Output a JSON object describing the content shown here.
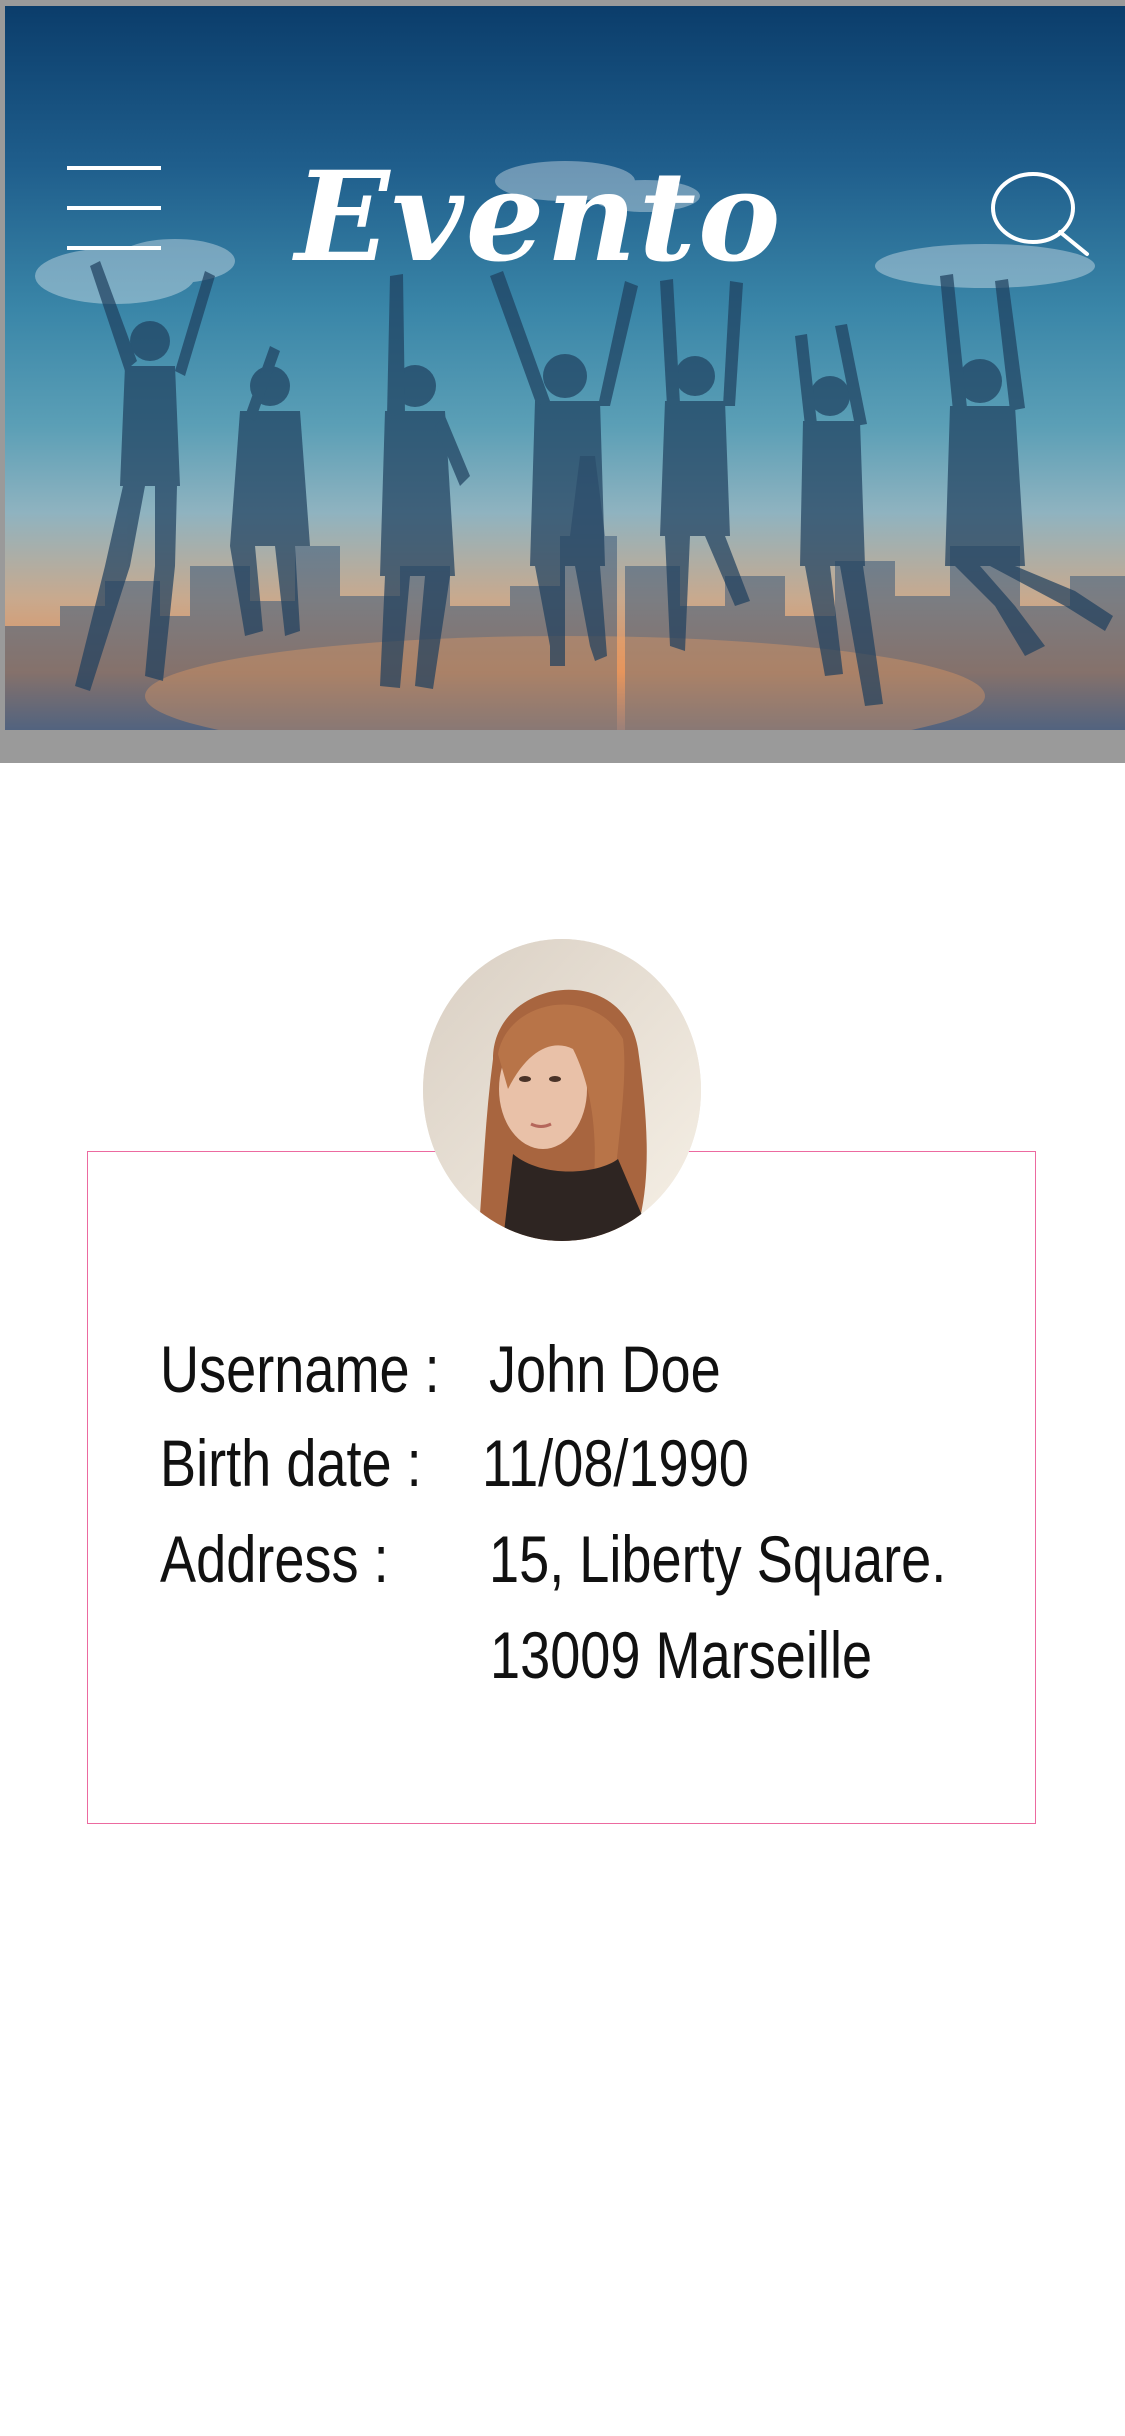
{
  "header": {
    "logo_text": "Evento",
    "menu_icon": "hamburger-menu-icon",
    "search_icon": "search-icon",
    "hero_image": "group of friends jumping over city skyline at sunset"
  },
  "profile": {
    "avatar_icon": "user-avatar",
    "fields": [
      {
        "label": "Username :",
        "value": "John Doe"
      },
      {
        "label": "Birth date :",
        "value": "11/08/1990"
      },
      {
        "label": "Address :",
        "value": "15, Liberty Square."
      },
      {
        "label": "",
        "value": "13009 Marseille"
      }
    ]
  },
  "colors": {
    "card_border": "#ec6aa0",
    "header_frame": "#9a9a9a",
    "text": "#111111"
  }
}
